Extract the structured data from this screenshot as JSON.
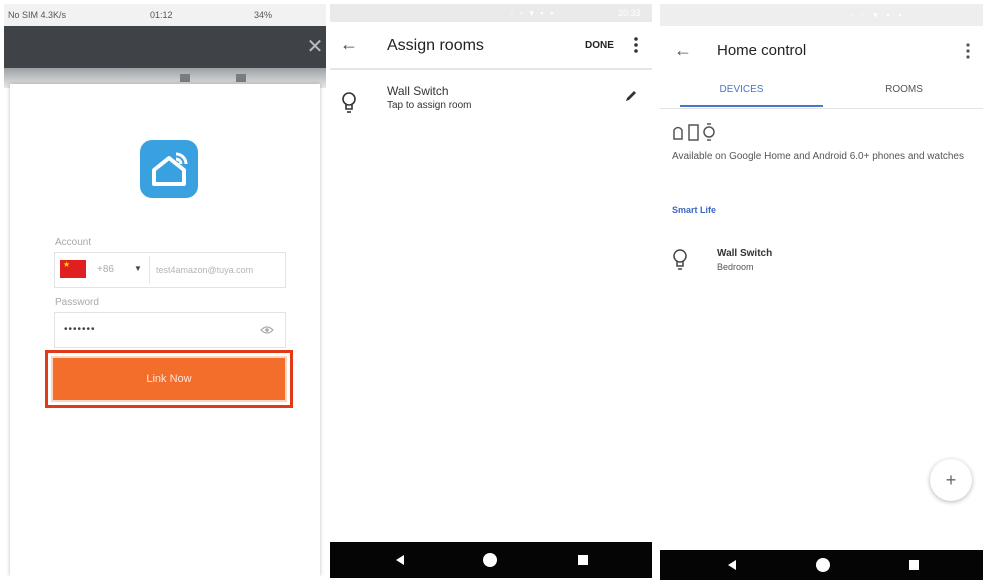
{
  "panel1": {
    "status_left": "No SIM 4.3K/s",
    "status_time": "01:12",
    "status_right": "34%",
    "account_label": "Account",
    "country_code": "+86",
    "account_value": "test4amazon@tuya.com",
    "password_label": "Password",
    "password_value": "•••••••",
    "link_button": "Link Now",
    "close_glyph": "✕"
  },
  "panel2": {
    "status_time": "20:33",
    "title": "Assign rooms",
    "done": "DONE",
    "device_name": "Wall Switch",
    "device_sub": "Tap to assign room"
  },
  "panel3": {
    "title": "Home control",
    "tab_devices": "DEVICES",
    "tab_rooms": "ROOMS",
    "availability": "Available on Google Home and Android 6.0+ phones and watches",
    "section": "Smart Life",
    "device_name": "Wall Switch",
    "device_room": "Bedroom",
    "fab_glyph": "+"
  },
  "colors": {
    "brand_orange": "#f36d2b",
    "highlight_red": "#e23a17",
    "tuya_blue": "#3aa1e0",
    "google_blue": "#4a75c8",
    "toolbar_dark": "#3f4347"
  }
}
